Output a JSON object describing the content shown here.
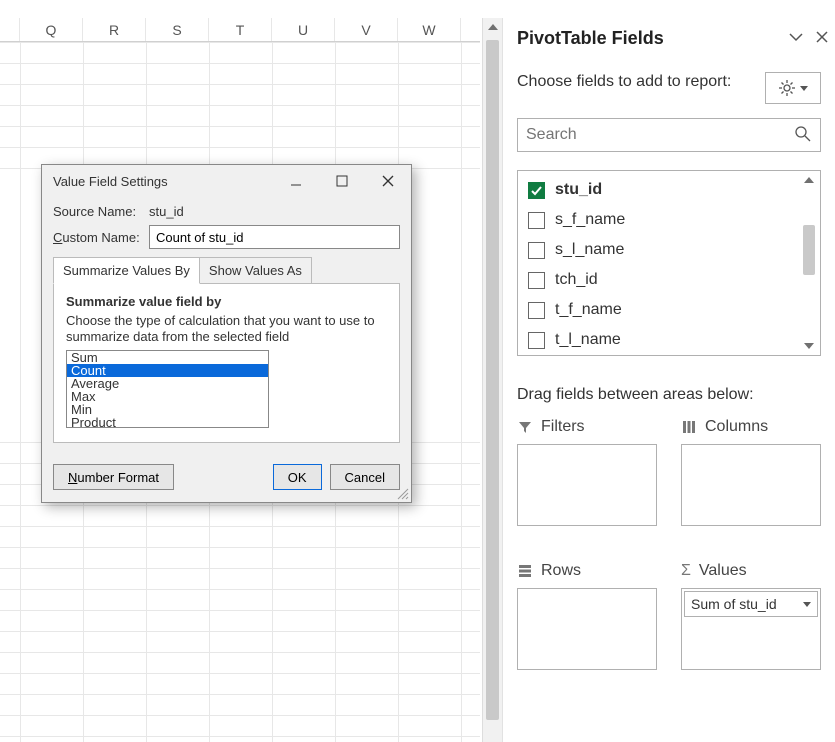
{
  "columns": [
    "Q",
    "R",
    "S",
    "T",
    "U",
    "V",
    "W"
  ],
  "dialog": {
    "title": "Value Field Settings",
    "sourceLabel": "Source Name:",
    "sourceValue": "stu_id",
    "customLabel_pre": "C",
    "customLabel_post": "ustom Name:",
    "customName": "Count of stu_id",
    "tabs": [
      "Summarize Values By",
      "Show Values As"
    ],
    "activeTab": 0,
    "panelHeading": "Summarize value field by",
    "panelDesc": "Choose the type of calculation that you want to use to summarize data from the selected field",
    "options": [
      "Sum",
      "Count",
      "Average",
      "Max",
      "Min",
      "Product"
    ],
    "selectedIndex": 1,
    "numberFormat_pre": "N",
    "numberFormat_post": "umber Format",
    "ok": "OK",
    "cancel": "Cancel"
  },
  "taskpane": {
    "title": "PivotTable Fields",
    "hint": "Choose fields to add to report:",
    "searchPlaceholder": "Search",
    "fields": [
      {
        "name": "stu_id",
        "checked": true
      },
      {
        "name": "s_f_name",
        "checked": false
      },
      {
        "name": "s_l_name",
        "checked": false
      },
      {
        "name": "tch_id",
        "checked": false
      },
      {
        "name": "t_f_name",
        "checked": false
      },
      {
        "name": "t_l_name",
        "checked": false
      }
    ],
    "dragHint": "Drag fields between areas below:",
    "areas": {
      "filters": "Filters",
      "columns": "Columns",
      "rows": "Rows",
      "values": "Values"
    },
    "valueChip": "Sum of stu_id"
  }
}
